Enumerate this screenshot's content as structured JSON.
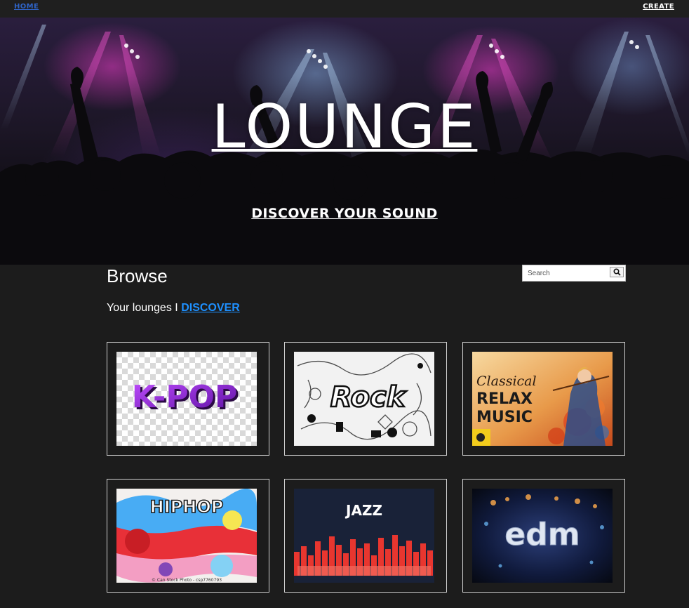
{
  "nav": {
    "home_label": "HOME",
    "create_label": "CREATE"
  },
  "hero": {
    "title": "LOUNGE",
    "subtitle": "DISCOVER YOUR SOUND"
  },
  "browse": {
    "title": "Browse",
    "search_placeholder": "Search",
    "search_icon": "search-icon",
    "tab_your_lounges": "Your lounges",
    "separator": "I",
    "tab_discover": "DISCOVER"
  },
  "genres": [
    {
      "name": "kpop",
      "img_text": "K-POP"
    },
    {
      "name": "rock",
      "img_text": "Rock"
    },
    {
      "name": "classical",
      "img_text_1": "Classical",
      "img_text_2": "RELAX",
      "img_text_3": "MUSIC"
    },
    {
      "name": "hiphop",
      "img_text": "HIPHOP",
      "credit": "© Can Stock Photo - csp7760793"
    },
    {
      "name": "jazz",
      "img_text": "JAZZ"
    },
    {
      "name": "edm",
      "img_text": "edm"
    }
  ],
  "colors": {
    "background": "#1c1c1c",
    "nav_home": "#2f63c5",
    "discover_link": "#1e90ff"
  }
}
